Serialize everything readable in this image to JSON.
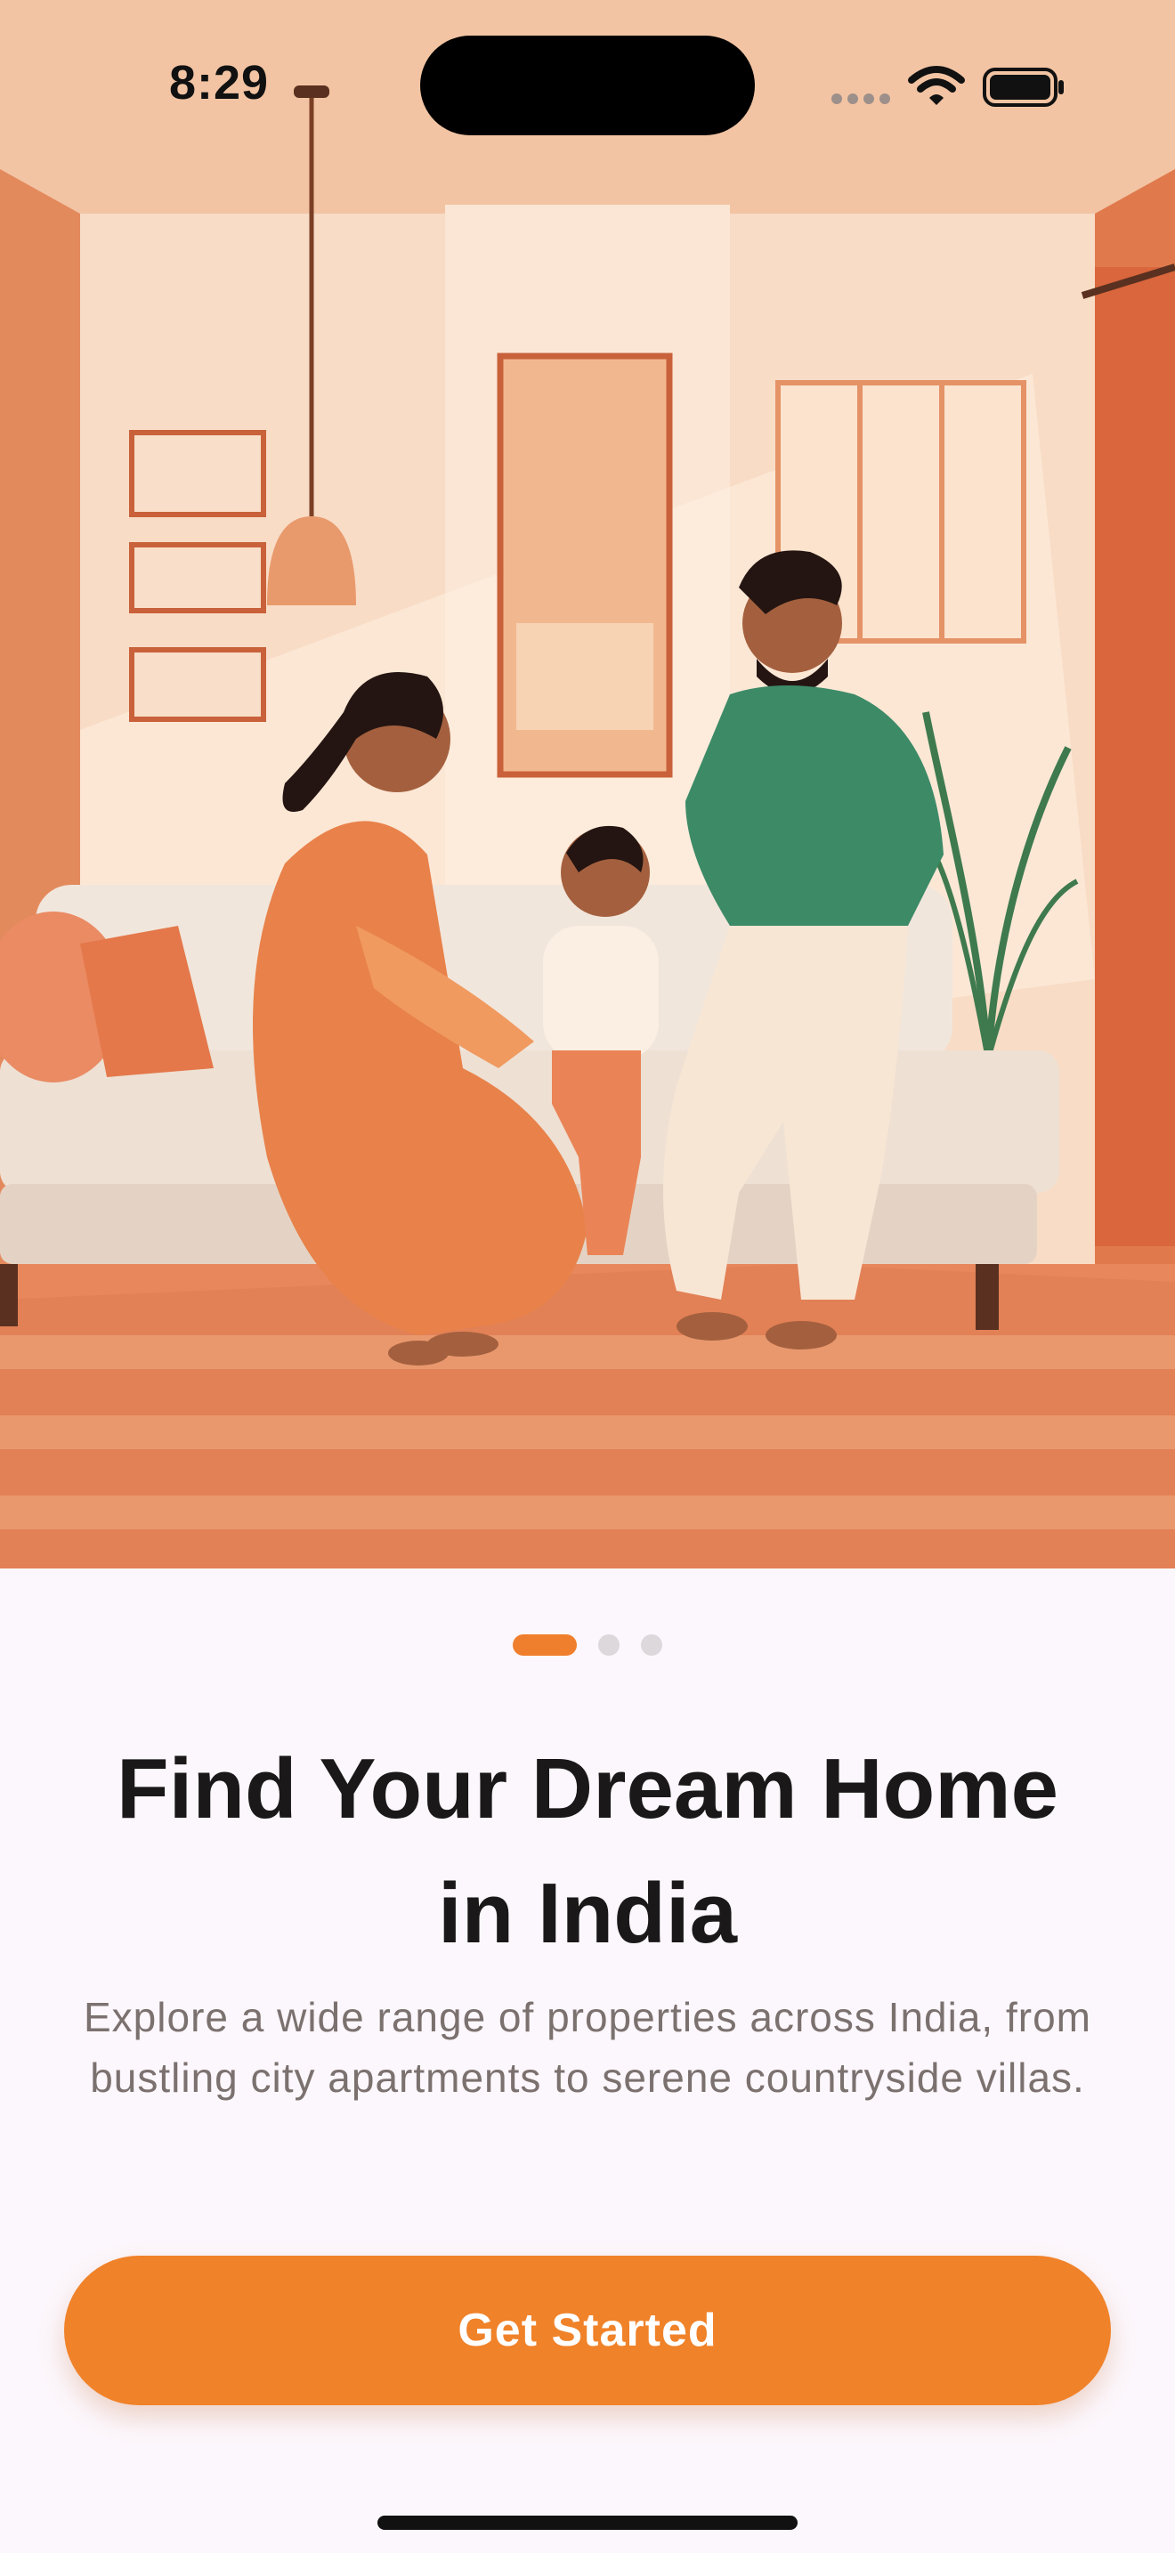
{
  "status_bar": {
    "time": "8:29"
  },
  "hero": {
    "illustration": "family-living-room-illustration"
  },
  "onboarding": {
    "page_count": 3,
    "active_page": 1,
    "title": "Find Your Dream Home in India",
    "subtitle": "Explore a wide range of properties across India, from bustling city apartments to serene countryside villas.",
    "cta_label": "Get Started"
  },
  "colors": {
    "accent": "#f08229",
    "background": "#fcf7fc",
    "title": "#1a1818",
    "subtitle": "#7b716f"
  }
}
